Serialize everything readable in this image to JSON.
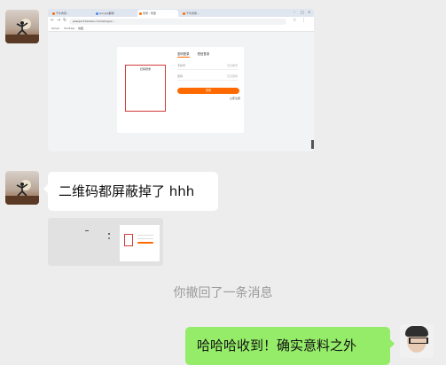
{
  "messages": [
    {
      "id": "msg-1",
      "type": "image",
      "description_role": "screenshot",
      "sender": "other"
    },
    {
      "id": "msg-2",
      "type": "text",
      "sender": "other",
      "text": "二维码都屏蔽掉了 hhh"
    },
    {
      "id": "msg-3",
      "type": "image",
      "sender": "other"
    },
    {
      "id": "msg-4",
      "type": "system",
      "text": "你撤回了一条消息"
    },
    {
      "id": "msg-5",
      "type": "text",
      "sender": "me",
      "text": "哈哈哈收到！确实意料之外"
    }
  ],
  "screenshot": {
    "tabs": [
      "千牛商家...",
      "Google翻译",
      "登录 - 阿里",
      "千牛商家..."
    ],
    "url": "passport.taobao.com/iv/login/...",
    "bookmarks": [
      "Gmail",
      "YouTube",
      "地图"
    ],
    "login": {
      "tab_password": "密码登录",
      "tab_sms": "短信登录",
      "field_account": "手机号",
      "field_account_hint": "忘记账号",
      "field_password": "密码",
      "field_password_hint": "忘记密码",
      "login_button": "登录",
      "register_link": "立即注册",
      "qr_title": "扫码登录"
    }
  },
  "colors": {
    "chat_bg": "#ededed",
    "my_bubble": "#95ec69",
    "other_bubble": "#ffffff",
    "brand_orange": "#ff6a00",
    "qr_border": "#d43b3b"
  }
}
